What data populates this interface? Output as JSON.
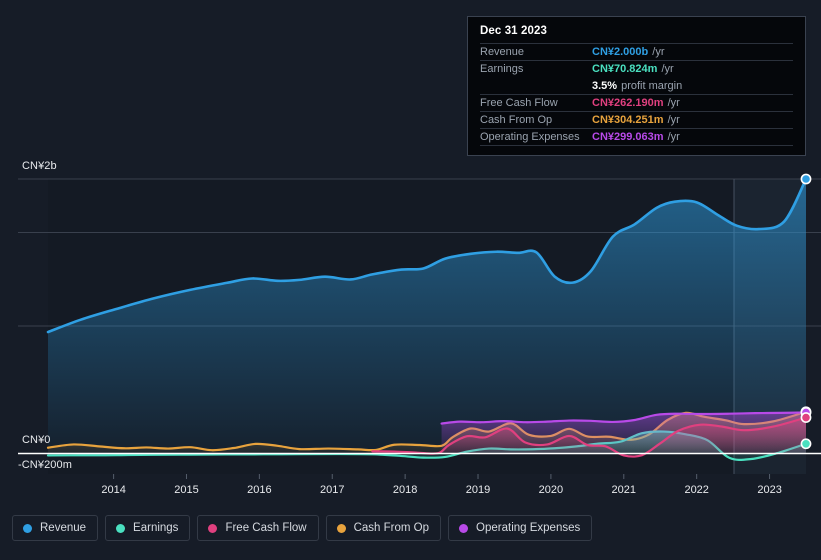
{
  "tooltip": {
    "title": "Dec 31 2023",
    "rows": [
      {
        "label": "Revenue",
        "value": "CN¥2.000b",
        "suffix": "/yr",
        "color": "#2f9fe3"
      },
      {
        "label": "Earnings",
        "value": "CN¥70.824m",
        "suffix": "/yr",
        "color": "#4ae0c0"
      },
      {
        "label": "",
        "value": "3.5%",
        "suffix": "profit margin",
        "color": "#ffffff"
      },
      {
        "label": "Free Cash Flow",
        "value": "CN¥262.190m",
        "suffix": "/yr",
        "color": "#e0407f"
      },
      {
        "label": "Cash From Op",
        "value": "CN¥304.251m",
        "suffix": "/yr",
        "color": "#e8a33d"
      },
      {
        "label": "Operating Expenses",
        "value": "CN¥299.063m",
        "suffix": "/yr",
        "color": "#b84ae8"
      }
    ]
  },
  "axes": {
    "y_top_label": "CN¥2b",
    "y_zero_label": "CN¥0",
    "y_neg_label": "-CN¥200m",
    "x_labels": [
      "2014",
      "2015",
      "2016",
      "2017",
      "2018",
      "2019",
      "2020",
      "2021",
      "2022",
      "2023"
    ]
  },
  "legend": [
    {
      "label": "Revenue",
      "color": "#2f9fe3"
    },
    {
      "label": "Earnings",
      "color": "#4ae0c0"
    },
    {
      "label": "Free Cash Flow",
      "color": "#e0407f"
    },
    {
      "label": "Cash From Op",
      "color": "#e8a33d"
    },
    {
      "label": "Operating Expenses",
      "color": "#b84ae8"
    }
  ],
  "chart_data": {
    "type": "area",
    "title": "",
    "xlabel": "",
    "ylabel": "",
    "ylim": [
      -200000000,
      2200000000
    ],
    "y_ticks": [
      -200000000,
      0,
      2000000000
    ],
    "y_tick_labels": [
      "-CN¥200m",
      "CN¥0",
      "CN¥2b"
    ],
    "x": [
      "2014",
      "2015",
      "2016",
      "2017",
      "2018",
      "2019",
      "2020",
      "2021",
      "2022",
      "2023"
    ],
    "grid": true,
    "legend_position": "bottom",
    "currency": "CNY",
    "forecast_boundary_year": 2023.3,
    "series": [
      {
        "name": "Revenue",
        "color": "#2f9fe3",
        "units": "CNY",
        "points": [
          {
            "t": 2013.55,
            "v": 885000000
          },
          {
            "t": 2014.0,
            "v": 975000000
          },
          {
            "t": 2014.5,
            "v": 1055000000
          },
          {
            "t": 2015.0,
            "v": 1130000000
          },
          {
            "t": 2015.5,
            "v": 1192000000
          },
          {
            "t": 2016.0,
            "v": 1243000000
          },
          {
            "t": 2016.35,
            "v": 1275000000
          },
          {
            "t": 2016.7,
            "v": 1258000000
          },
          {
            "t": 2017.0,
            "v": 1265000000
          },
          {
            "t": 2017.35,
            "v": 1288000000
          },
          {
            "t": 2017.7,
            "v": 1268000000
          },
          {
            "t": 2018.0,
            "v": 1305000000
          },
          {
            "t": 2018.4,
            "v": 1340000000
          },
          {
            "t": 2018.7,
            "v": 1348000000
          },
          {
            "t": 2019.0,
            "v": 1420000000
          },
          {
            "t": 2019.35,
            "v": 1455000000
          },
          {
            "t": 2019.7,
            "v": 1470000000
          },
          {
            "t": 2020.0,
            "v": 1462000000
          },
          {
            "t": 2020.25,
            "v": 1466000000
          },
          {
            "t": 2020.5,
            "v": 1290000000
          },
          {
            "t": 2020.75,
            "v": 1245000000
          },
          {
            "t": 2021.0,
            "v": 1330000000
          },
          {
            "t": 2021.3,
            "v": 1580000000
          },
          {
            "t": 2021.6,
            "v": 1670000000
          },
          {
            "t": 2021.9,
            "v": 1790000000
          },
          {
            "t": 2022.15,
            "v": 1835000000
          },
          {
            "t": 2022.45,
            "v": 1830000000
          },
          {
            "t": 2022.75,
            "v": 1735000000
          },
          {
            "t": 2023.0,
            "v": 1660000000
          },
          {
            "t": 2023.3,
            "v": 1635000000
          },
          {
            "t": 2023.65,
            "v": 1690000000
          },
          {
            "t": 2023.95,
            "v": 2000000000
          }
        ]
      },
      {
        "name": "Earnings",
        "color": "#4ae0c0",
        "units": "CNY",
        "points": [
          {
            "t": 2013.55,
            "v": -14000000
          },
          {
            "t": 2014.0,
            "v": -13000000
          },
          {
            "t": 2014.5,
            "v": -12000000
          },
          {
            "t": 2015.0,
            "v": -9000000
          },
          {
            "t": 2015.5,
            "v": -8000000
          },
          {
            "t": 2016.0,
            "v": -7000000
          },
          {
            "t": 2016.5,
            "v": -6000000
          },
          {
            "t": 2017.0,
            "v": -5000000
          },
          {
            "t": 2017.5,
            "v": -4000000
          },
          {
            "t": 2018.0,
            "v": -6000000
          },
          {
            "t": 2018.35,
            "v": -16000000
          },
          {
            "t": 2018.7,
            "v": -30000000
          },
          {
            "t": 2019.0,
            "v": -25000000
          },
          {
            "t": 2019.3,
            "v": 14000000
          },
          {
            "t": 2019.6,
            "v": 36000000
          },
          {
            "t": 2019.9,
            "v": 30000000
          },
          {
            "t": 2020.2,
            "v": 31000000
          },
          {
            "t": 2020.5,
            "v": 38000000
          },
          {
            "t": 2020.8,
            "v": 52000000
          },
          {
            "t": 2021.1,
            "v": 72000000
          },
          {
            "t": 2021.4,
            "v": 86000000
          },
          {
            "t": 2021.7,
            "v": 148000000
          },
          {
            "t": 2022.0,
            "v": 160000000
          },
          {
            "t": 2022.3,
            "v": 140000000
          },
          {
            "t": 2022.6,
            "v": 96000000
          },
          {
            "t": 2022.9,
            "v": -32000000
          },
          {
            "t": 2023.2,
            "v": -40000000
          },
          {
            "t": 2023.55,
            "v": 2000000
          },
          {
            "t": 2023.95,
            "v": 70824000
          }
        ]
      },
      {
        "name": "Free Cash Flow",
        "color": "#e0407f",
        "units": "CNY",
        "starts_at": 2018.0,
        "points": [
          {
            "t": 2018.0,
            "v": 16000000
          },
          {
            "t": 2018.3,
            "v": 14000000
          },
          {
            "t": 2018.6,
            "v": 7000000
          },
          {
            "t": 2018.9,
            "v": 2000000
          },
          {
            "t": 2019.05,
            "v": 62000000
          },
          {
            "t": 2019.3,
            "v": 126000000
          },
          {
            "t": 2019.55,
            "v": 118000000
          },
          {
            "t": 2019.85,
            "v": 182000000
          },
          {
            "t": 2020.1,
            "v": 80000000
          },
          {
            "t": 2020.4,
            "v": 66000000
          },
          {
            "t": 2020.7,
            "v": 128000000
          },
          {
            "t": 2020.95,
            "v": 62000000
          },
          {
            "t": 2021.2,
            "v": 52000000
          },
          {
            "t": 2021.45,
            "v": -14000000
          },
          {
            "t": 2021.7,
            "v": -12000000
          },
          {
            "t": 2021.95,
            "v": 74000000
          },
          {
            "t": 2022.2,
            "v": 166000000
          },
          {
            "t": 2022.5,
            "v": 210000000
          },
          {
            "t": 2022.8,
            "v": 196000000
          },
          {
            "t": 2023.1,
            "v": 170000000
          },
          {
            "t": 2023.5,
            "v": 196000000
          },
          {
            "t": 2023.95,
            "v": 262190000
          }
        ]
      },
      {
        "name": "Cash From Op",
        "color": "#e8a33d",
        "units": "CNY",
        "points": [
          {
            "t": 2013.55,
            "v": 42000000
          },
          {
            "t": 2013.9,
            "v": 66000000
          },
          {
            "t": 2014.25,
            "v": 52000000
          },
          {
            "t": 2014.6,
            "v": 38000000
          },
          {
            "t": 2014.9,
            "v": 44000000
          },
          {
            "t": 2015.2,
            "v": 36000000
          },
          {
            "t": 2015.5,
            "v": 46000000
          },
          {
            "t": 2015.8,
            "v": 24000000
          },
          {
            "t": 2016.1,
            "v": 40000000
          },
          {
            "t": 2016.4,
            "v": 70000000
          },
          {
            "t": 2016.7,
            "v": 56000000
          },
          {
            "t": 2017.0,
            "v": 32000000
          },
          {
            "t": 2017.4,
            "v": 36000000
          },
          {
            "t": 2017.8,
            "v": 30000000
          },
          {
            "t": 2018.05,
            "v": 26000000
          },
          {
            "t": 2018.3,
            "v": 64000000
          },
          {
            "t": 2018.65,
            "v": 62000000
          },
          {
            "t": 2018.95,
            "v": 56000000
          },
          {
            "t": 2019.1,
            "v": 118000000
          },
          {
            "t": 2019.35,
            "v": 182000000
          },
          {
            "t": 2019.6,
            "v": 160000000
          },
          {
            "t": 2019.9,
            "v": 220000000
          },
          {
            "t": 2020.15,
            "v": 136000000
          },
          {
            "t": 2020.45,
            "v": 128000000
          },
          {
            "t": 2020.7,
            "v": 180000000
          },
          {
            "t": 2020.95,
            "v": 124000000
          },
          {
            "t": 2021.25,
            "v": 122000000
          },
          {
            "t": 2021.55,
            "v": 100000000
          },
          {
            "t": 2021.8,
            "v": 140000000
          },
          {
            "t": 2022.05,
            "v": 244000000
          },
          {
            "t": 2022.3,
            "v": 296000000
          },
          {
            "t": 2022.55,
            "v": 268000000
          },
          {
            "t": 2022.85,
            "v": 242000000
          },
          {
            "t": 2023.1,
            "v": 214000000
          },
          {
            "t": 2023.5,
            "v": 234000000
          },
          {
            "t": 2023.95,
            "v": 304251000
          }
        ]
      },
      {
        "name": "Operating Expenses",
        "color": "#b84ae8",
        "units": "CNY",
        "starts_at": 2018.95,
        "points": [
          {
            "t": 2018.95,
            "v": 218000000
          },
          {
            "t": 2019.2,
            "v": 232000000
          },
          {
            "t": 2019.5,
            "v": 228000000
          },
          {
            "t": 2019.8,
            "v": 236000000
          },
          {
            "t": 2020.1,
            "v": 228000000
          },
          {
            "t": 2020.4,
            "v": 232000000
          },
          {
            "t": 2020.7,
            "v": 240000000
          },
          {
            "t": 2021.0,
            "v": 238000000
          },
          {
            "t": 2021.3,
            "v": 230000000
          },
          {
            "t": 2021.6,
            "v": 244000000
          },
          {
            "t": 2021.9,
            "v": 282000000
          },
          {
            "t": 2022.2,
            "v": 290000000
          },
          {
            "t": 2022.55,
            "v": 288000000
          },
          {
            "t": 2022.9,
            "v": 290000000
          },
          {
            "t": 2023.25,
            "v": 294000000
          },
          {
            "t": 2023.6,
            "v": 296000000
          },
          {
            "t": 2023.95,
            "v": 299063000
          }
        ]
      }
    ]
  }
}
